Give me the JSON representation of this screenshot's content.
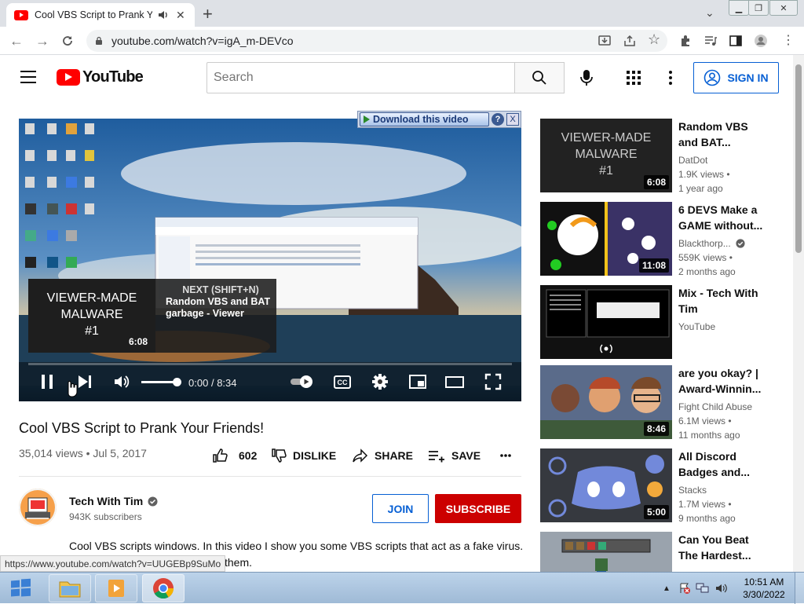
{
  "browser": {
    "tab_title": "Cool VBS Script to Prank You",
    "url": "youtube.com/watch?v=igA_m-DEVco",
    "status_url": "https://www.youtube.com/watch?v=UUGEBp9SuMo"
  },
  "youtube": {
    "logo_text": "YouTube",
    "search_placeholder": "Search",
    "sign_in": "SIGN IN"
  },
  "player": {
    "download_label": "Download this video",
    "help": "?",
    "close": "X",
    "next_label": "NEXT (SHIFT+N)",
    "next_title": "Random VBS and BAT garbage - Viewer",
    "next_duration": "6:08",
    "thumb_text": [
      "VIEWER-MADE",
      "MALWARE",
      "#1"
    ],
    "time_current": "0:00",
    "time_separator": "/",
    "time_total": "8:34",
    "cc": "CC"
  },
  "video": {
    "title": "Cool VBS Script to Prank Your Friends!",
    "views": "35,014 views",
    "date": "Jul 5, 2017",
    "likes": "602",
    "dislike": "DISLIKE",
    "share": "SHARE",
    "save": "SAVE"
  },
  "channel": {
    "name": "Tech With Tim",
    "subscribers": "943K subscribers",
    "join": "JOIN",
    "subscribe": "SUBSCRIBE",
    "description": "Cool VBS scripts windows. In this video I show you some VBS scripts that act as a fake virus.",
    "description_tail": "them."
  },
  "recommendations": [
    {
      "title": "Random VBS and BAT...",
      "channel": "DatDot",
      "views": "1.9K views",
      "age": "1 year ago",
      "duration": "6:08"
    },
    {
      "title": "6 DEVS Make a GAME without...",
      "channel": "Blackthorp...",
      "views": "559K views",
      "age": "2 months ago",
      "duration": "11:08",
      "verified": true
    },
    {
      "title": "Mix - Tech With Tim",
      "channel": "YouTube",
      "duration": ""
    },
    {
      "title": "are you okay? | Award-Winnin...",
      "channel": "Fight Child Abuse",
      "views": "6.1M views",
      "age": "11 months ago",
      "duration": "8:46"
    },
    {
      "title": "All Discord Badges and...",
      "channel": "Stacks",
      "views": "1.7M views",
      "age": "9 months ago",
      "duration": "5:00"
    },
    {
      "title": "Can You Beat The Hardest...",
      "channel": "",
      "duration": ""
    }
  ],
  "taskbar": {
    "time": "10:51 AM",
    "date": "3/30/2022"
  },
  "colors": {
    "yt_red": "#ff0000",
    "subscribe_red": "#cc0000",
    "link_blue": "#065fd4",
    "chrome_tabstrip": "#dee1e6"
  }
}
